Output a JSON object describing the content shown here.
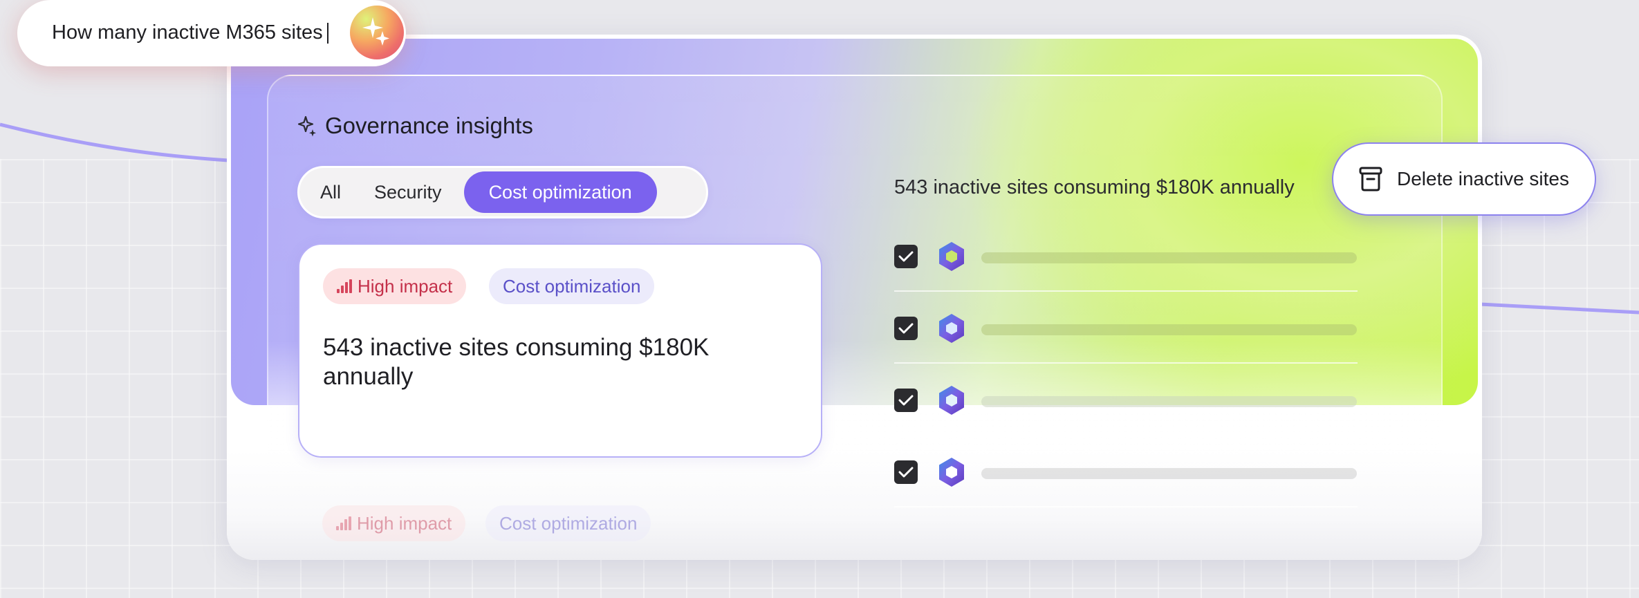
{
  "prompt": {
    "query_text": "How many inactive M365 sites",
    "icon": "copilot-sparkle-icon"
  },
  "panel": {
    "heading": "Governance insights",
    "heading_icon": "sparkle-icon",
    "tabs": [
      {
        "label": "All",
        "active": false
      },
      {
        "label": "Security",
        "active": false
      },
      {
        "label": "Cost optimization",
        "active": true
      }
    ]
  },
  "insight_card": {
    "impact_badge": "High impact",
    "category_badge": "Cost optimization",
    "description": "543 inactive sites consuming $180K annually"
  },
  "insight_card_next": {
    "impact_badge": "High impact",
    "category_badge": "Cost optimization"
  },
  "sites_list": {
    "title": "543 inactive sites consuming $180K annually",
    "rows": [
      {
        "checked": true,
        "icon": "sharepoint-hexagon-icon"
      },
      {
        "checked": true,
        "icon": "sharepoint-hexagon-icon"
      },
      {
        "checked": true,
        "icon": "sharepoint-hexagon-icon"
      },
      {
        "checked": true,
        "icon": "sharepoint-hexagon-icon"
      }
    ]
  },
  "actions": {
    "delete_label": "Delete inactive sites",
    "delete_icon": "archive-trash-icon"
  },
  "colors": {
    "accent": "#7b62ee",
    "lime": "#c7f548",
    "high_impact_text": "#c4304a",
    "high_impact_bg": "#fde1e2",
    "category_bg": "#ecebfb"
  }
}
